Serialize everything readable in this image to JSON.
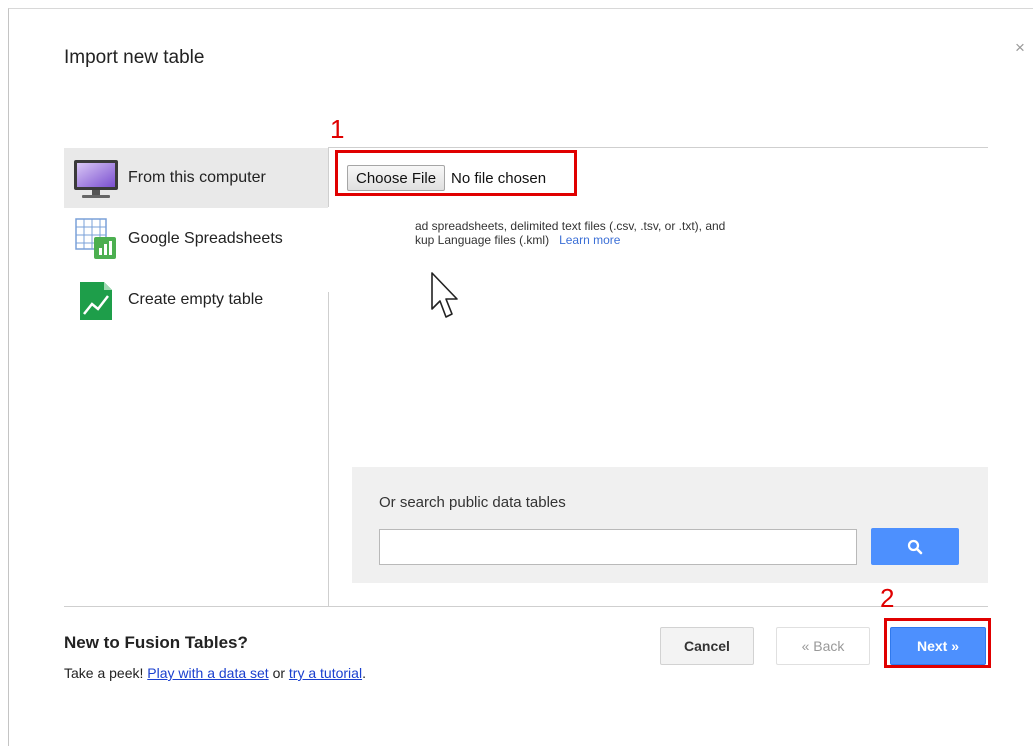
{
  "dialog": {
    "title": "Import new table",
    "close_glyph": "×"
  },
  "sidebar": {
    "items": [
      {
        "label": "From this computer",
        "icon": "monitor-icon",
        "active": true
      },
      {
        "label": "Google Spreadsheets",
        "icon": "spreadsheet-icon",
        "active": false
      },
      {
        "label": "Create empty table",
        "icon": "new-table-icon",
        "active": false
      }
    ]
  },
  "upload": {
    "choose_label": "Choose File",
    "no_file_text": "No file chosen",
    "info_line1": "ad spreadsheets, delimited text files (.csv, .tsv, or .txt), and",
    "info_line2": "kup Language files (.kml)",
    "learn_more": "Learn more"
  },
  "search": {
    "label": "Or search public data tables",
    "value": "",
    "placeholder": "",
    "icon": "search-icon"
  },
  "footer": {
    "title": "New to Fusion Tables?",
    "prefix": "Take a peek!",
    "link1": "Play with a data set",
    "middle": "or",
    "link2": "try a tutorial",
    "suffix": "."
  },
  "buttons": {
    "cancel": "Cancel",
    "back": "« Back",
    "next": "Next »"
  },
  "annotations": {
    "marker1": "1",
    "marker2": "2"
  },
  "colors": {
    "accent": "#4d90fe",
    "annotation_red": "#e00000"
  }
}
